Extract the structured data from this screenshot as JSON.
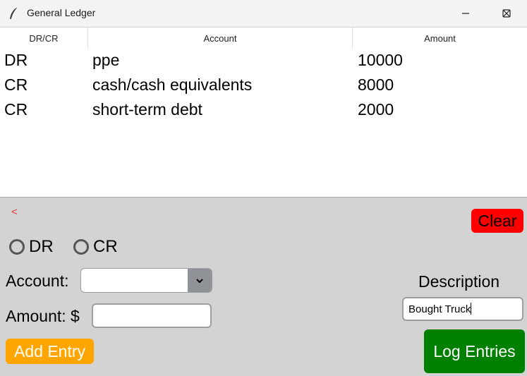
{
  "window": {
    "title": "General Ledger"
  },
  "table": {
    "headers": [
      "DR/CR",
      "Account",
      "Amount"
    ],
    "rows": [
      {
        "drcr": "DR",
        "account": "ppe",
        "amount": "10000"
      },
      {
        "drcr": "CR",
        "account": "cash/cash equivalents",
        "amount": "8000"
      },
      {
        "drcr": "CR",
        "account": "short-term debt",
        "amount": "2000"
      }
    ]
  },
  "form": {
    "back_label": "<",
    "clear_label": "Clear",
    "radio_dr_label": "DR",
    "radio_cr_label": "CR",
    "account_label": "Account:",
    "account_value": "",
    "amount_label": "Amount: $",
    "amount_value": "",
    "description_label": "Description",
    "description_value": "Bought Truck",
    "add_entry_label": "Add Entry",
    "log_entries_label": "Log Entries"
  },
  "colors": {
    "clear": "#ff0000",
    "add_entry": "#ffa500",
    "log_entries": "#008000",
    "back_link": "#e53935",
    "panel": "#d3d3d3"
  },
  "icons": {
    "app": "feather-icon",
    "minimize": "minimize-icon",
    "maximize": "maximize-icon",
    "close": "close-icon",
    "dropdown": "chevron-down-icon"
  }
}
